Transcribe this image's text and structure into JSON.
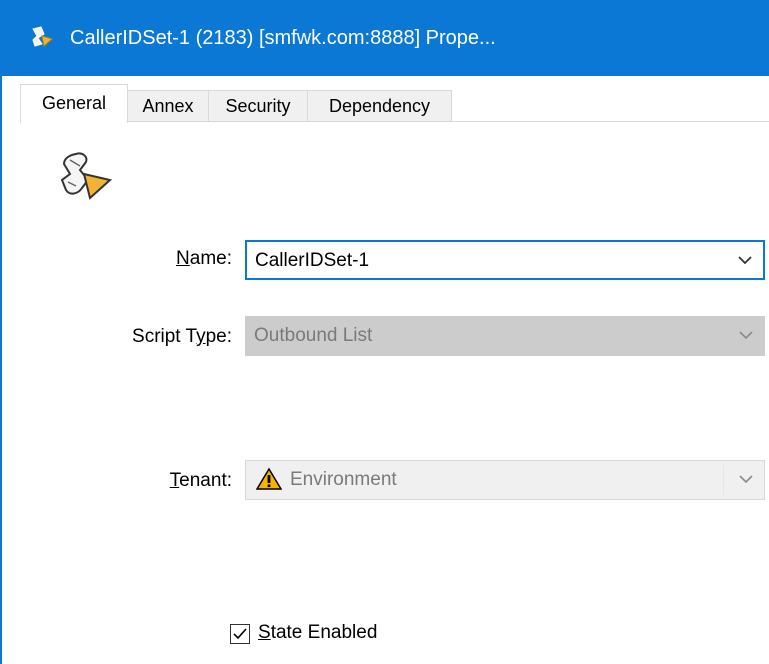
{
  "window": {
    "title": "CallerIDSet-1 (2183) [smfwk.com:8888] Prope...",
    "accent": "#0a78d4",
    "icon": "script-icon"
  },
  "tabs": [
    {
      "label": "General",
      "active": true
    },
    {
      "label": "Annex",
      "active": false
    },
    {
      "label": "Security",
      "active": false
    },
    {
      "label": "Dependency",
      "active": false
    }
  ],
  "general": {
    "page_icon": "script-icon",
    "name": {
      "label_u": "N",
      "label_rest": "ame:",
      "value": "CallerIDSet-1"
    },
    "script_type": {
      "label_a": "Script T",
      "label_u": "y",
      "label_b": "pe:",
      "value": "Outbound List"
    },
    "tenant": {
      "label_u": "T",
      "label_rest": "enant:",
      "value": "Environment",
      "icon": "warning-icon"
    },
    "state_enabled": {
      "label_u": "S",
      "label_rest": "tate Enabled",
      "checked": true
    }
  }
}
